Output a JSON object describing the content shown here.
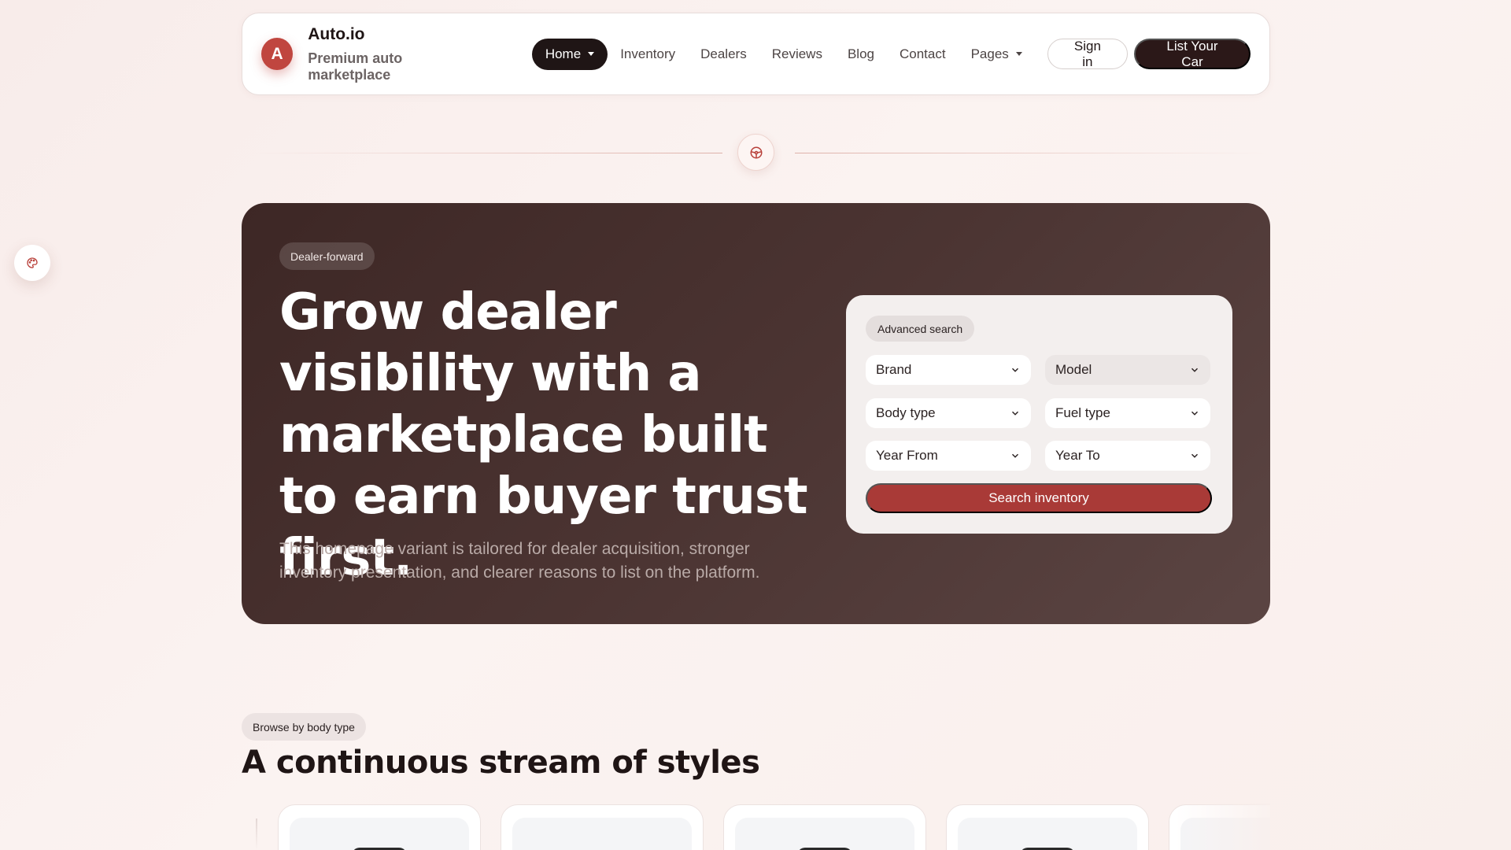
{
  "brand": {
    "logo_letter": "A",
    "name": "Auto.io",
    "tagline": "Premium auto marketplace"
  },
  "nav": {
    "items": [
      {
        "label": "Home",
        "active": true,
        "has_caret": true
      },
      {
        "label": "Inventory"
      },
      {
        "label": "Dealers"
      },
      {
        "label": "Reviews"
      },
      {
        "label": "Blog"
      },
      {
        "label": "Contact"
      },
      {
        "label": "Pages",
        "has_caret": true
      }
    ],
    "sign_in": "Sign in",
    "list_car": "List Your Car"
  },
  "hero": {
    "badge": "Dealer-forward",
    "title": "Grow dealer visibility with a marketplace built to earn buyer trust first.",
    "subtitle": "This homepage variant is tailored for dealer acquisition, stronger inventory presentation, and clearer reasons to list on the platform."
  },
  "search": {
    "badge": "Advanced search",
    "fields": {
      "brand": "Brand",
      "model": "Model",
      "body_type": "Body type",
      "fuel_type": "Fuel type",
      "year_from": "Year From",
      "year_to": "Year To"
    },
    "button": "Search inventory"
  },
  "browse": {
    "badge": "Browse by body type",
    "title": "A continuous stream of styles"
  },
  "icons": {
    "divider": "steering-wheel-icon",
    "floating": "palette-icon",
    "select": "chevron-down-icon"
  },
  "colors": {
    "accent": "#c0463f",
    "search_button": "#a93a37",
    "dark": "#2b1818",
    "hero_bg": "#4b3432"
  }
}
